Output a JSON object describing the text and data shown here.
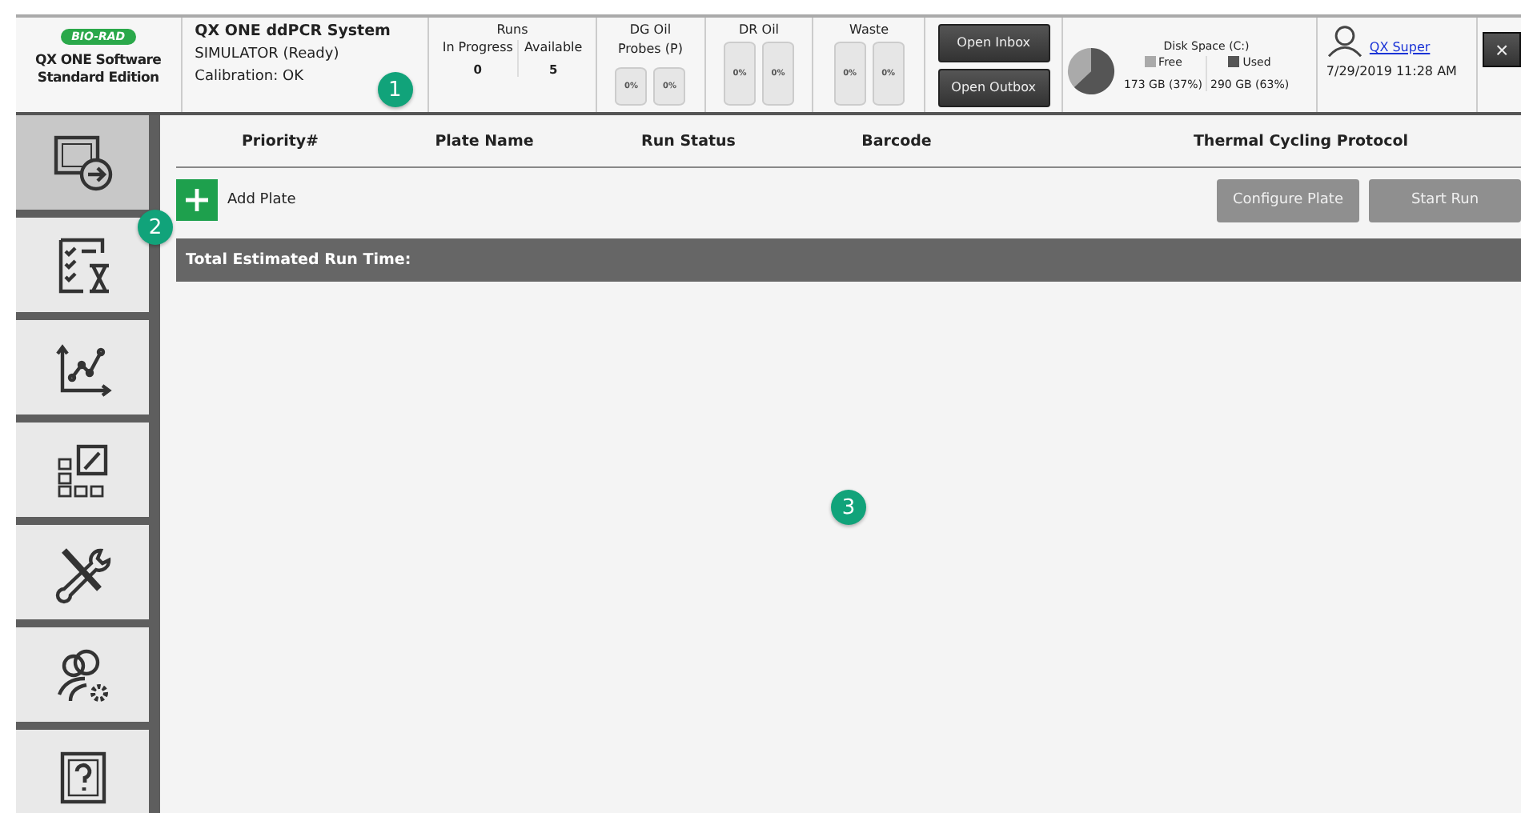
{
  "app": {
    "logo": "BIO-RAD",
    "name_line1": "QX ONE Software",
    "name_line2": "Standard Edition"
  },
  "system": {
    "title": "QX ONE ddPCR System",
    "status": "SIMULATOR (Ready)",
    "calibration": "Calibration: OK"
  },
  "runs": {
    "title": "Runs",
    "columns": [
      {
        "label": "In Progress",
        "value": "0"
      },
      {
        "label": "Available",
        "value": "5"
      }
    ]
  },
  "reservoirs": [
    {
      "title": "DG Oil",
      "subtitle": "Probes (P)",
      "tanks": [
        {
          "reading": "0%"
        },
        {
          "reading": "0%"
        }
      ]
    },
    {
      "title": "DR Oil",
      "tanks": [
        {
          "reading": "0%"
        },
        {
          "reading": "0%"
        }
      ]
    },
    {
      "title": "Waste",
      "tanks": [
        {
          "reading": "0%"
        },
        {
          "reading": "0%"
        }
      ]
    }
  ],
  "buttons": [
    "Open Inbox",
    "Open Outbox"
  ],
  "disk": {
    "readings": [
      "173 GB (37%)",
      "290 GB (63%)"
    ],
    "chart_data": {
      "type": "pie",
      "title": "Disk Space (C:)",
      "categories": [
        "Free",
        "Used"
      ],
      "values": [
        37,
        63
      ],
      "colors": [
        "#aaaaaa",
        "#555555"
      ]
    }
  },
  "user": {
    "name": "QX Super",
    "datetime": "7/29/2019 11:28 AM"
  },
  "close": "×",
  "sidebar": {
    "items": [
      {
        "kind": "run",
        "selected": true
      },
      {
        "kind": "checklist",
        "selected": false
      },
      {
        "kind": "chart",
        "selected": false
      },
      {
        "kind": "layout",
        "selected": false
      },
      {
        "kind": "tools",
        "selected": false
      },
      {
        "kind": "users",
        "selected": false
      },
      {
        "kind": "help",
        "selected": false
      }
    ]
  },
  "table": {
    "columns": [
      "Priority#",
      "Plate Name",
      "Run Status",
      "Barcode",
      "Thermal Cycling Protocol"
    ]
  },
  "add_plate": "Add Plate",
  "actions": [
    {
      "label": "Configure Plate",
      "disabled": true
    },
    {
      "label": "Start Run",
      "disabled": true
    }
  ],
  "total_bar": "Total Estimated Run Time:",
  "callouts": [
    "1",
    "2",
    "3"
  ]
}
